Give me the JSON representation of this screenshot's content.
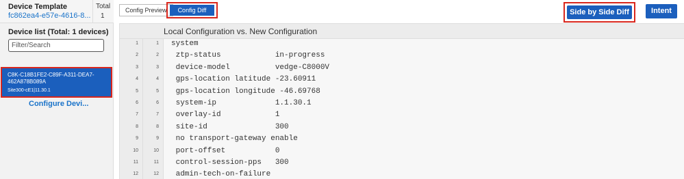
{
  "template": {
    "label": "Device Template",
    "id": "fc862ea4-e57e-4616-8...",
    "total_label": "Total",
    "total_value": "1"
  },
  "device_list": {
    "title": "Device list (Total: 1 devices)",
    "filter_placeholder": "Filter/Search",
    "devices": [
      {
        "id": "C8K-C18B1FE2-C89F-A311-DEA7-462A878B089A",
        "detail": "Site300-cE1|11.30.1"
      }
    ],
    "configure_label": "Configure Devi..."
  },
  "tabs": {
    "preview": "Config Preview",
    "diff": "Config Diff"
  },
  "actions": {
    "side_by_side": "Side by Side Diff",
    "intent": "Intent"
  },
  "diff": {
    "title": "Local Configuration vs. New Configuration",
    "lines": [
      {
        "a": "1",
        "b": "1",
        "text": "system"
      },
      {
        "a": "2",
        "b": "2",
        "text": " ztp-status            in-progress"
      },
      {
        "a": "3",
        "b": "3",
        "text": " device-model          vedge-C8000V"
      },
      {
        "a": "4",
        "b": "4",
        "text": " gps-location latitude -23.60911"
      },
      {
        "a": "5",
        "b": "5",
        "text": " gps-location longitude -46.69768"
      },
      {
        "a": "6",
        "b": "6",
        "text": " system-ip             1.1.30.1"
      },
      {
        "a": "7",
        "b": "7",
        "text": " overlay-id            1"
      },
      {
        "a": "8",
        "b": "8",
        "text": " site-id               300"
      },
      {
        "a": "9",
        "b": "9",
        "text": " no transport-gateway enable"
      },
      {
        "a": "10",
        "b": "10",
        "text": " port-offset           0"
      },
      {
        "a": "11",
        "b": "11",
        "text": " control-session-pps   300"
      },
      {
        "a": "12",
        "b": "12",
        "text": " admin-tech-on-failure"
      }
    ]
  },
  "colors": {
    "accent": "#1b5fbd",
    "highlight_border": "#d9261c",
    "link": "#1a73c9"
  }
}
